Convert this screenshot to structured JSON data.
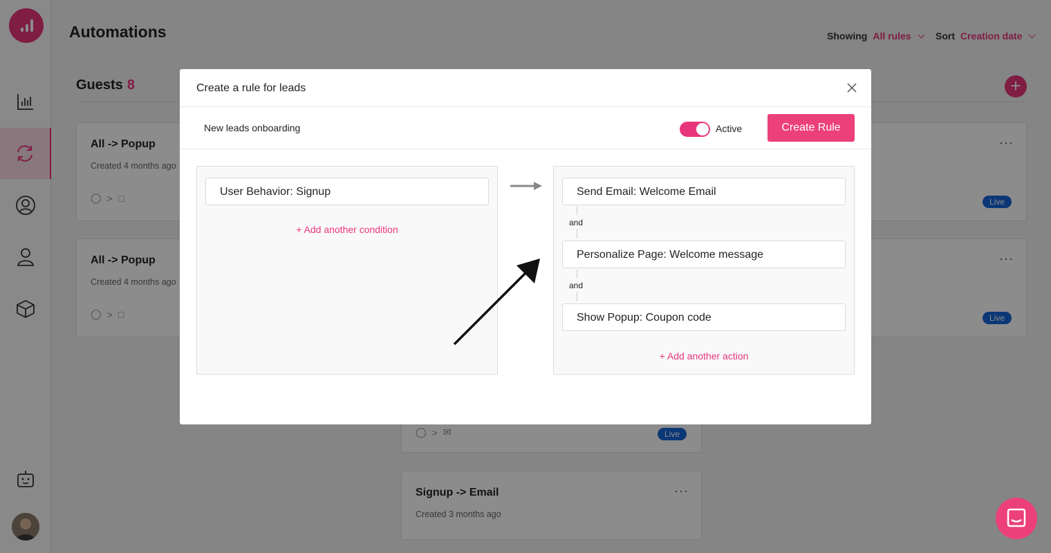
{
  "sidebar": {
    "items": [
      {
        "name": "analytics",
        "icon": "bar-chart-icon"
      },
      {
        "name": "automations",
        "icon": "refresh-icon",
        "active": true
      },
      {
        "name": "contacts",
        "icon": "user-circle-icon"
      },
      {
        "name": "personas",
        "icon": "user-icon"
      },
      {
        "name": "products",
        "icon": "cube-icon"
      }
    ],
    "bottom_icon": "robot-icon"
  },
  "header": {
    "title": "Automations",
    "showing_label": "Showing",
    "showing_value": "All rules",
    "sort_label": "Sort",
    "sort_value": "Creation date"
  },
  "section": {
    "title": "Guests",
    "count": "8"
  },
  "cards": [
    {
      "title": "All -> Popup",
      "created": "Created 4 months ago",
      "status": "Live"
    },
    {
      "title": "All -> Popup",
      "created": "Created 4 months ago",
      "status": "Live"
    },
    {
      "title": "",
      "created": "",
      "status": "Live"
    },
    {
      "title": "Signup -> Email",
      "created": "Created 3 months ago",
      "status": ""
    }
  ],
  "modal": {
    "title": "Create a rule for leads",
    "rule_name": "New leads onboarding",
    "active_label": "Active",
    "active": true,
    "create_button": "Create Rule",
    "conditions": [
      "User Behavior: Signup"
    ],
    "add_condition": "+ Add another condition",
    "actions": [
      "Send Email: Welcome Email",
      "Personalize Page: Welcome message",
      "Show Popup: Coupon code"
    ],
    "and_label": "and",
    "add_action": "+ Add another action"
  },
  "colors": {
    "accent": "#e8357b",
    "live_badge": "#1565d8"
  }
}
